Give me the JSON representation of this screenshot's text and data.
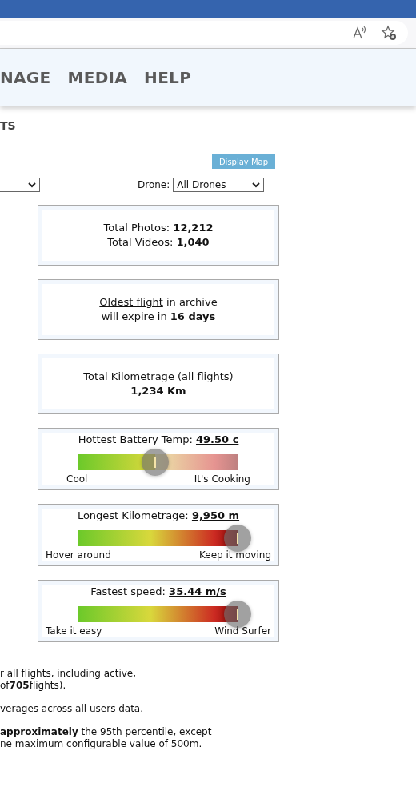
{
  "nav": {
    "items": [
      "NAGE",
      "MEDIA",
      "HELP"
    ]
  },
  "section_title": "TS",
  "display_map_button": "Display Map",
  "filters": {
    "drone_label": "Drone:",
    "drone_value": "All Drones"
  },
  "cards": [
    {
      "kind": "text",
      "lines": [
        "Total Photos: **12,212**",
        "Total Videos: **1,040**"
      ]
    },
    {
      "kind": "link-text",
      "link": "Oldest flight",
      "after": " in archive",
      "line2": "will expire in **16 days**"
    },
    {
      "kind": "text",
      "lines": [
        "Total Kilometrage (all flights)",
        "**1,234 Km**"
      ]
    },
    {
      "kind": "gauge",
      "title": "Hottest Battery Temp: ",
      "value": "49.50 c",
      "level": 0.48,
      "left_label": "Cool",
      "right_label": "It's Cooking"
    },
    {
      "kind": "gauge-top",
      "title": "Longest Kilometrage: ",
      "value": "9,950 m",
      "left_label": "Hover around",
      "right_label": "Keep it moving"
    },
    {
      "kind": "gauge-top",
      "title": "Fastest speed: ",
      "value": "35.44 m/s",
      "left_label": "Take it easy",
      "right_label": "Wind Surfer"
    }
  ],
  "notes": [
    [
      "r all flights, including active,",
      "of**705**flights)."
    ],
    [
      "verages across all users data."
    ],
    [
      "**approximately** the 95th percentile, except",
      "ne maximum configurable value of 500m."
    ]
  ]
}
